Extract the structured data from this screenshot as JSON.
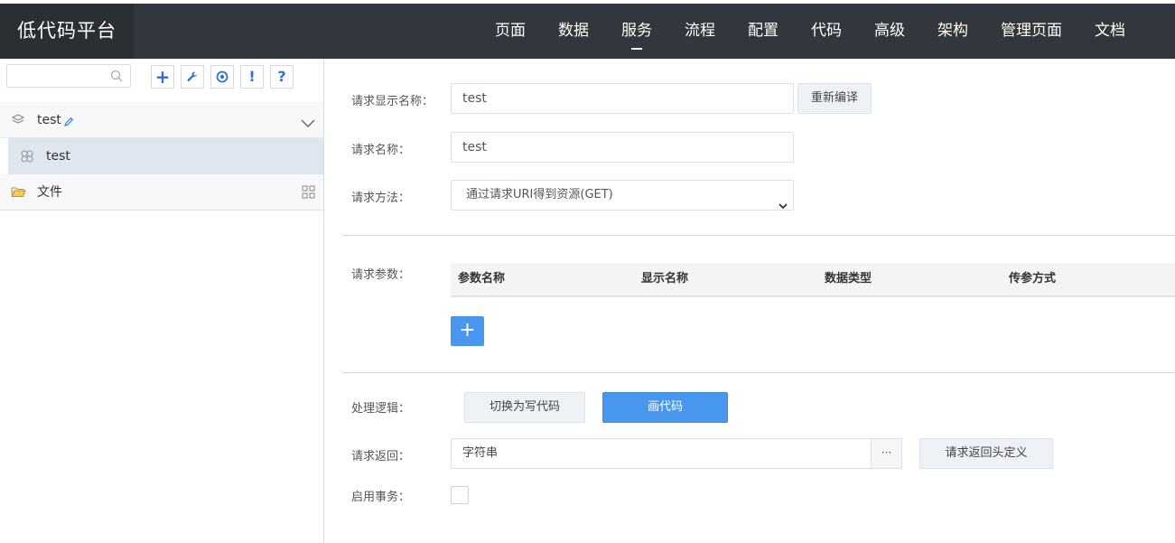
{
  "app": {
    "title": "低代码平台"
  },
  "nav": {
    "items": [
      {
        "label": "页面",
        "active": false
      },
      {
        "label": "数据",
        "active": false
      },
      {
        "label": "服务",
        "active": true
      },
      {
        "label": "流程",
        "active": false
      },
      {
        "label": "配置",
        "active": false
      },
      {
        "label": "代码",
        "active": false
      },
      {
        "label": "高级",
        "active": false
      },
      {
        "label": "架构",
        "active": false
      },
      {
        "label": "管理页面",
        "active": false
      },
      {
        "label": "文档",
        "active": false
      }
    ]
  },
  "sidebar": {
    "search": {
      "placeholder": "",
      "value": ""
    },
    "toolbar": [
      {
        "icon": "plus-icon",
        "glyph": "+"
      },
      {
        "icon": "wrench-icon",
        "glyph": "🔧"
      },
      {
        "icon": "target-icon",
        "glyph": "◎"
      },
      {
        "icon": "exclamation-icon",
        "glyph": "!"
      },
      {
        "icon": "question-icon",
        "glyph": "?"
      }
    ],
    "tree": {
      "group": {
        "label": "test",
        "icon": "layers-icon",
        "edit_icon": "pencil-icon",
        "expand_icon": "chevron-down-icon"
      },
      "child": {
        "label": "test",
        "icon": "service-node-icon"
      },
      "files": {
        "label": "文件",
        "icon": "folder-open-icon",
        "action_icon": "grid-icon"
      }
    }
  },
  "form": {
    "display_name": {
      "label": "请求显示名称：",
      "value": "test"
    },
    "recompile_button": "重新编译",
    "name": {
      "label": "请求名称：",
      "value": "test"
    },
    "method": {
      "label": "请求方法：",
      "value": "通过请求URI得到资源(GET)"
    },
    "params": {
      "label": "请求参数：",
      "columns": [
        "参数名称",
        "显示名称",
        "数据类型",
        "传参方式"
      ],
      "add_label": "+"
    },
    "logic": {
      "label": "处理逻辑：",
      "switch_button": "切换为写代码",
      "draw_button": "画代码"
    },
    "returns": {
      "label": "请求返回：",
      "value": "字符串",
      "more_label": "···",
      "header_button": "请求返回头定义"
    },
    "transaction": {
      "label": "启用事务：",
      "checked": false
    }
  },
  "colors": {
    "topbar": "#32373d",
    "logo_bg": "#2a2f34",
    "primary": "#4996ee",
    "icon_blue": "#2f6fd6",
    "selected_row": "#dfe6ef"
  }
}
